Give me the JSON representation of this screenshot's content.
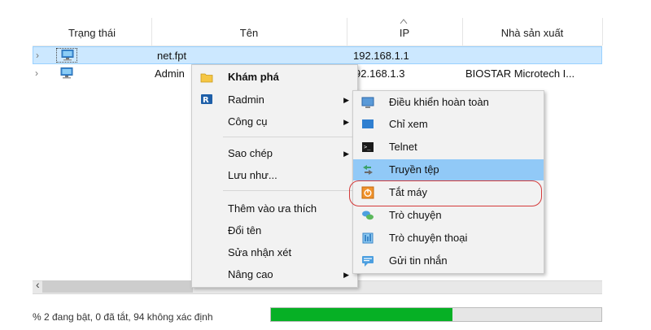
{
  "columns": [
    "Trạng thái",
    "Tên",
    "IP",
    "Nhà sản xuất"
  ],
  "rows": [
    {
      "name": "net.fpt",
      "ip": "192.168.1.1",
      "vendor": ""
    },
    {
      "name": "Admin",
      "ip": "92.168.1.3",
      "vendor": "BIOSTAR Microtech I..."
    }
  ],
  "context_menu": [
    {
      "label": "Khám phá",
      "bold": true
    },
    {
      "label": "Radmin",
      "submenu": true
    },
    {
      "label": "Công cụ",
      "submenu": true
    },
    {
      "label": "Sao chép",
      "submenu": true
    },
    {
      "label": "Lưu như..."
    },
    {
      "label": "Thêm vào ưa thích"
    },
    {
      "label": "Đổi tên"
    },
    {
      "label": "Sửa nhận xét"
    },
    {
      "label": "Nâng cao",
      "submenu": true
    }
  ],
  "radmin_submenu": [
    "Điều khiển hoàn toàn",
    "Chỉ xem",
    "Telnet",
    "Truyền tệp",
    "Tắt máy",
    "Trò chuyện",
    "Trò chuyện thoại",
    "Gửi tin nhắn"
  ],
  "status_text": "% 2 đang bật, 0 đã tắt, 94 không xác định",
  "scroll_left_glyph": "‹",
  "progress": 0.55,
  "colors": {
    "selection": "#cce8ff",
    "menu_highlight": "#91c9f7",
    "progress": "#06b025",
    "callout": "#d43a3a"
  },
  "icons": {
    "row": "computer-icon",
    "explore": "folder-icon",
    "radmin": "radmin-icon",
    "full_control": "monitor-icon",
    "view_only": "screen-icon",
    "telnet": "terminal-icon",
    "file_transfer": "file-transfer-icon",
    "shutdown": "power-icon",
    "chat": "chat-icon",
    "voice_chat": "voice-chat-icon",
    "message": "message-icon"
  }
}
